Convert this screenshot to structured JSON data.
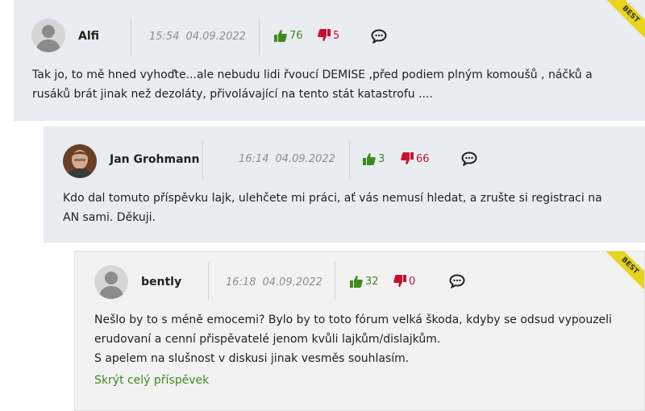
{
  "comments": [
    {
      "user": "Alfi",
      "time": "15:54",
      "date": "04.09.2022",
      "likes": "76",
      "dislikes": "5",
      "badge": "BEST",
      "text": "Tak jo, to mě hned vyhoďte...ale nebudu lidi řvoucí DEMISE ,před podiem plným komoušů , náčků a rusáků brát jinak než dezoláty, přivolávající na tento stát katastrofu ...."
    },
    {
      "user": "Jan Grohmann",
      "time": "16:14",
      "date": "04.09.2022",
      "likes": "3",
      "dislikes": "66",
      "text": "Kdo dal tomuto příspěvku lajk, ulehčete mi práci, ať vás nemusí hledat, a zrušte si registraci na AN sami. Děkuji."
    },
    {
      "user": "bently",
      "time": "16:18",
      "date": "04.09.2022",
      "likes": "32",
      "dislikes": "0",
      "badge": "BEST",
      "text_lines": [
        "Nešlo by to s méně emocemi? Bylo by to toto fórum velká škoda, kdyby se odsud vypouzeli",
        "erudovaní a cenní přispěvatelé jenom kvůli lajkům/dislajkům.",
        "S apelem na slušnost v diskusi jinak vesměs souhlasím."
      ],
      "hide_link": "Skrýt celý příspěvek"
    }
  ],
  "icons": {
    "like": "thumbs-up-icon",
    "dislike": "thumbs-down-icon",
    "reply": "speech-bubble-icon",
    "avatar": "user-avatar"
  },
  "colors": {
    "like": "#3f8a1d",
    "dislike": "#c8102e",
    "badge": "#e6d51a",
    "panel": "#e9ecf1"
  }
}
